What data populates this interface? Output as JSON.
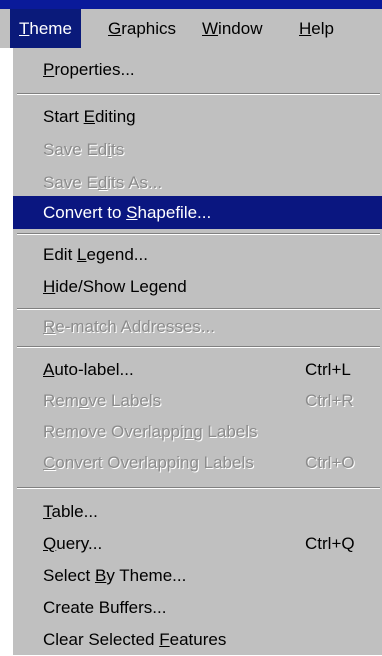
{
  "menubar": {
    "items": [
      {
        "pre": "",
        "acc": "T",
        "post": "heme"
      },
      {
        "pre": "",
        "acc": "G",
        "post": "raphics"
      },
      {
        "pre": "",
        "acc": "W",
        "post": "indow"
      },
      {
        "pre": "",
        "acc": "H",
        "post": "elp"
      }
    ]
  },
  "menu": {
    "items": [
      {
        "pre": "",
        "acc": "P",
        "post": "roperties...",
        "shortcut": "",
        "disabled": false,
        "selected": false
      },
      {
        "pre": "Start ",
        "acc": "E",
        "post": "diting",
        "shortcut": "",
        "disabled": false,
        "selected": false
      },
      {
        "pre": "Save Ed",
        "acc": "i",
        "post": "ts",
        "shortcut": "",
        "disabled": true,
        "selected": false
      },
      {
        "pre": "Save E",
        "acc": "d",
        "post": "its As...",
        "shortcut": "",
        "disabled": true,
        "selected": false
      },
      {
        "pre": "Convert to ",
        "acc": "S",
        "post": "hapefile...",
        "shortcut": "",
        "disabled": false,
        "selected": true
      },
      {
        "pre": "Edit ",
        "acc": "L",
        "post": "egend...",
        "shortcut": "",
        "disabled": false,
        "selected": false
      },
      {
        "pre": "",
        "acc": "H",
        "post": "ide/Show Legend",
        "shortcut": "",
        "disabled": false,
        "selected": false
      },
      {
        "pre": "",
        "acc": "R",
        "post": "e-match Addresses...",
        "shortcut": "",
        "disabled": true,
        "selected": false
      },
      {
        "pre": "",
        "acc": "A",
        "post": "uto-label...",
        "shortcut": "Ctrl+L",
        "disabled": false,
        "selected": false
      },
      {
        "pre": "Rem",
        "acc": "o",
        "post": "ve Labels",
        "shortcut": "Ctrl+R",
        "disabled": true,
        "selected": false
      },
      {
        "pre": "Remove Overlappi",
        "acc": "n",
        "post": "g Labels",
        "shortcut": "",
        "disabled": true,
        "selected": false
      },
      {
        "pre": "",
        "acc": "C",
        "post": "onvert Overlapping Labels",
        "shortcut": "Ctrl+O",
        "disabled": true,
        "selected": false
      },
      {
        "pre": "",
        "acc": "T",
        "post": "able...",
        "shortcut": "",
        "disabled": false,
        "selected": false
      },
      {
        "pre": "",
        "acc": "Q",
        "post": "uery...",
        "shortcut": "Ctrl+Q",
        "disabled": false,
        "selected": false
      },
      {
        "pre": "Select ",
        "acc": "B",
        "post": "y Theme...",
        "shortcut": "",
        "disabled": false,
        "selected": false
      },
      {
        "pre": "Create Buffers...",
        "acc": "",
        "post": "",
        "shortcut": "",
        "disabled": false,
        "selected": false
      },
      {
        "pre": "Clear Selected ",
        "acc": "F",
        "post": "eatures",
        "shortcut": "",
        "disabled": false,
        "selected": false
      }
    ]
  }
}
